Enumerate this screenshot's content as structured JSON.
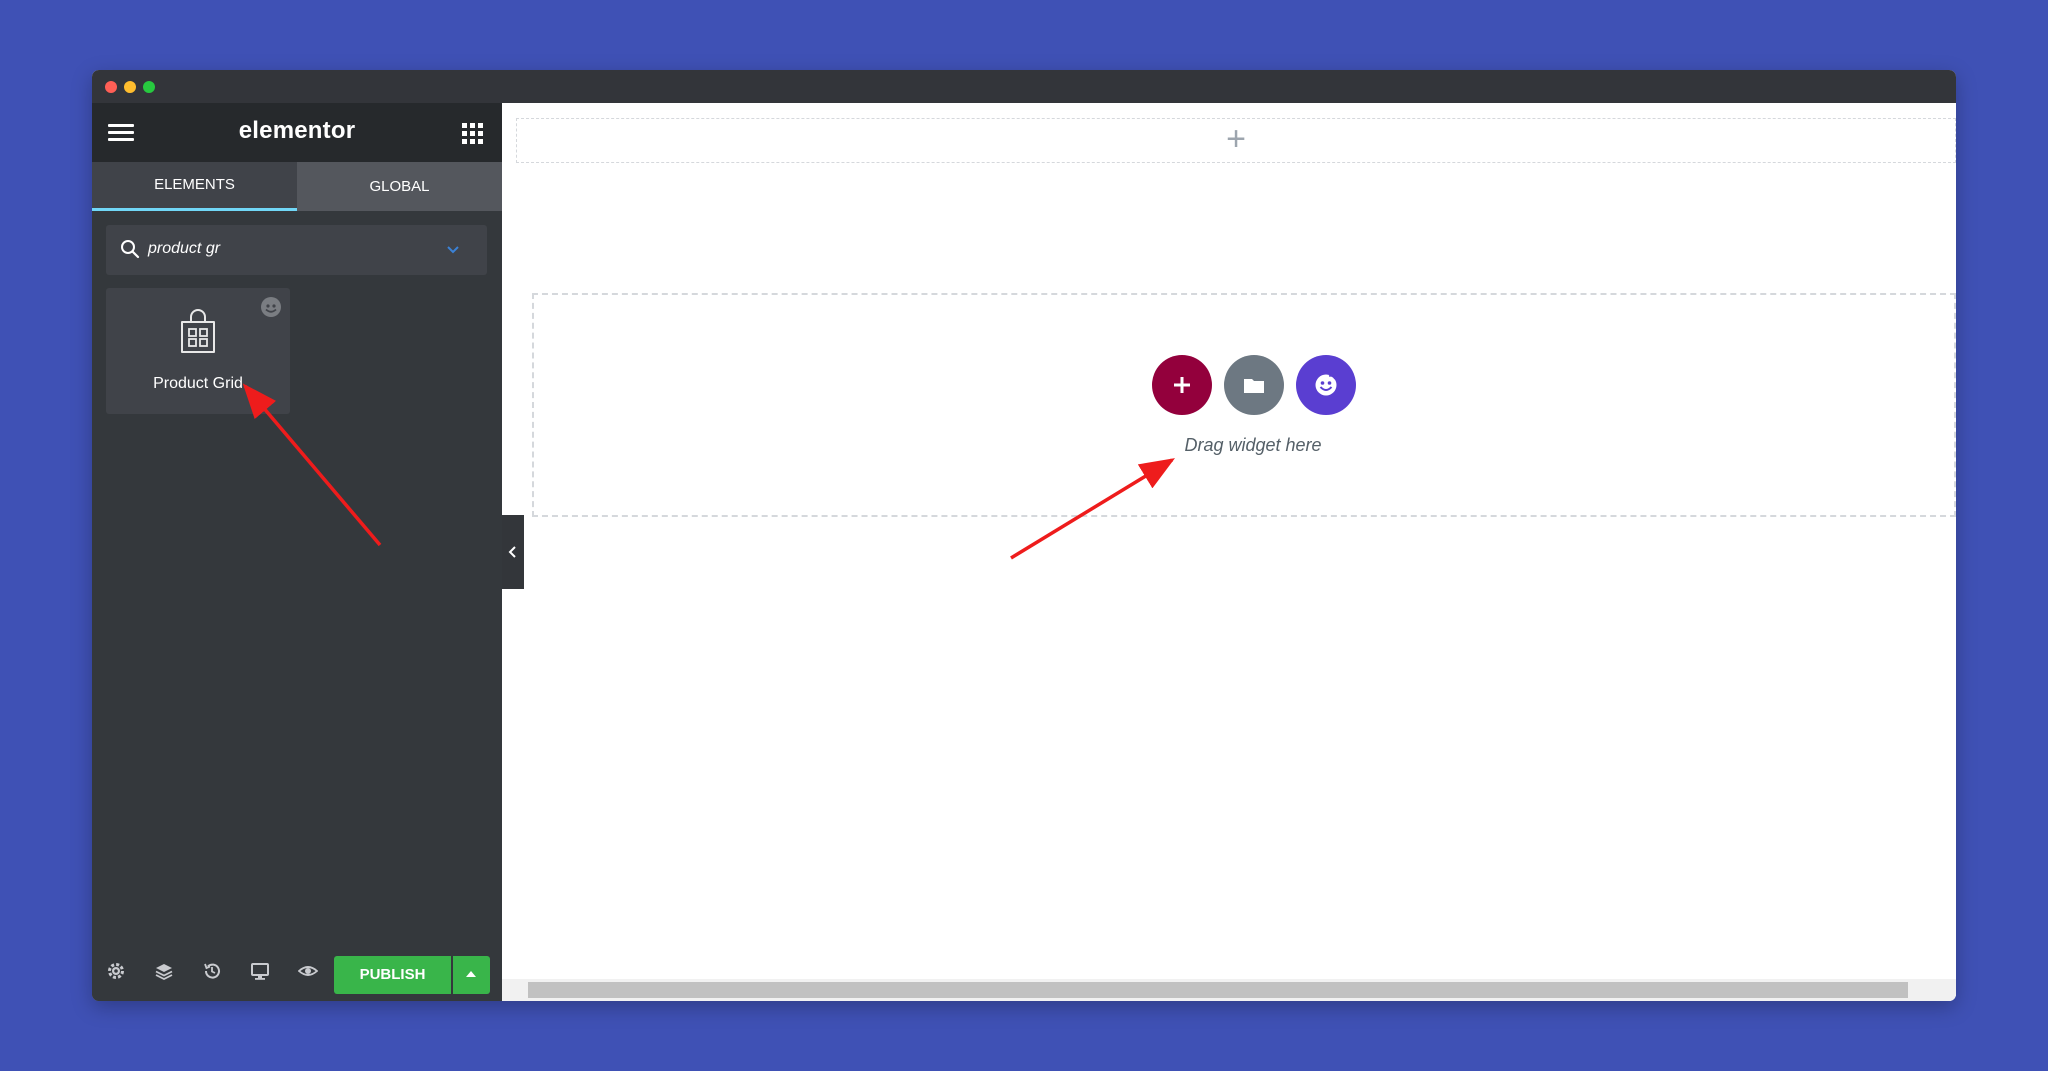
{
  "header": {
    "logo": "elementor"
  },
  "tabs": [
    {
      "label": "ELEMENTS",
      "active": true
    },
    {
      "label": "GLOBAL",
      "active": false
    }
  ],
  "search": {
    "value": "product gr"
  },
  "widgets": [
    {
      "label": "Product Grid"
    }
  ],
  "footer": {
    "publish_label": "PUBLISH"
  },
  "canvas": {
    "drop_hint": "Drag widget here",
    "add_symbol": "+"
  },
  "colors": {
    "background": "#3f51b5",
    "panel": "#34383c",
    "publish": "#39b54a",
    "add_circle": "#93003c",
    "template_circle": "#6d7882",
    "ekit_circle": "#5a3ed1",
    "annotation_arrow": "#ee1c1c"
  },
  "icons": [
    "menu-icon",
    "apps-grid-icon",
    "search-icon",
    "chevron-down-icon",
    "shopping-bag-icon",
    "elementskit-badge-icon",
    "settings-icon",
    "layers-icon",
    "history-icon",
    "responsive-icon",
    "preview-icon",
    "plus-icon",
    "folder-icon",
    "elementskit-icon",
    "collapse-icon"
  ]
}
